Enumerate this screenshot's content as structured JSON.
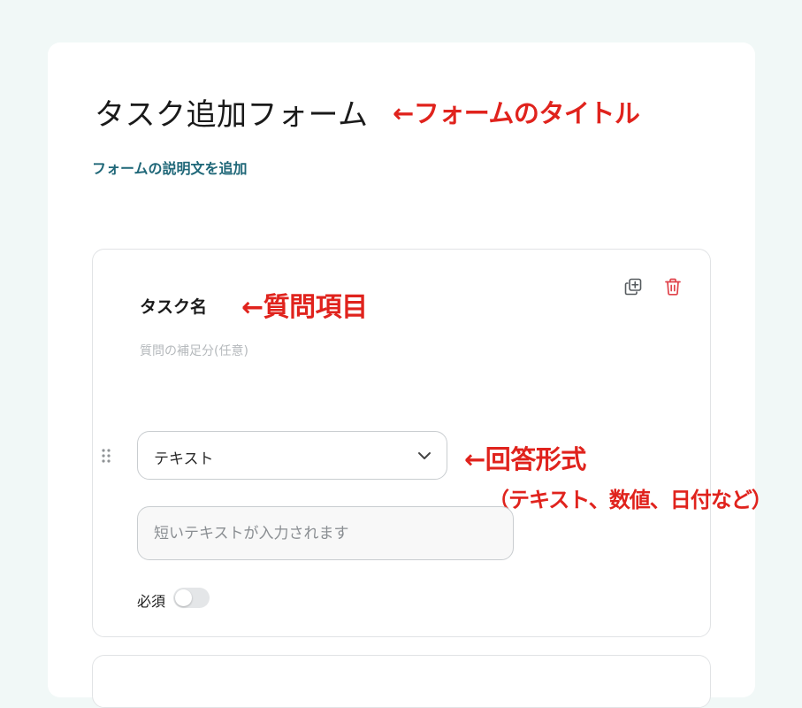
{
  "form": {
    "title": "タスク追加フォーム",
    "add_description_label": "フォームの説明文を追加"
  },
  "question": {
    "label": "タスク名",
    "help_placeholder": "質問の補足分(任意)",
    "answer_type": "テキスト",
    "answer_placeholder": "短いテキストが入力されます",
    "required_label": "必須",
    "required": false,
    "icons": {
      "copy": "copy-icon",
      "delete": "trash-icon",
      "drag": "drag-handle-icon",
      "select": "chevron-down-icon"
    }
  },
  "annotations": {
    "title": "←フォームのタイトル",
    "question": "←質問項目",
    "answer": "←回答形式",
    "answer_note": "（テキスト、数値、日付など）"
  },
  "colors": {
    "background": "#f1f8f7",
    "annotation": "#e0231d",
    "link": "#1f6778",
    "delete_icon": "#e0434b"
  }
}
